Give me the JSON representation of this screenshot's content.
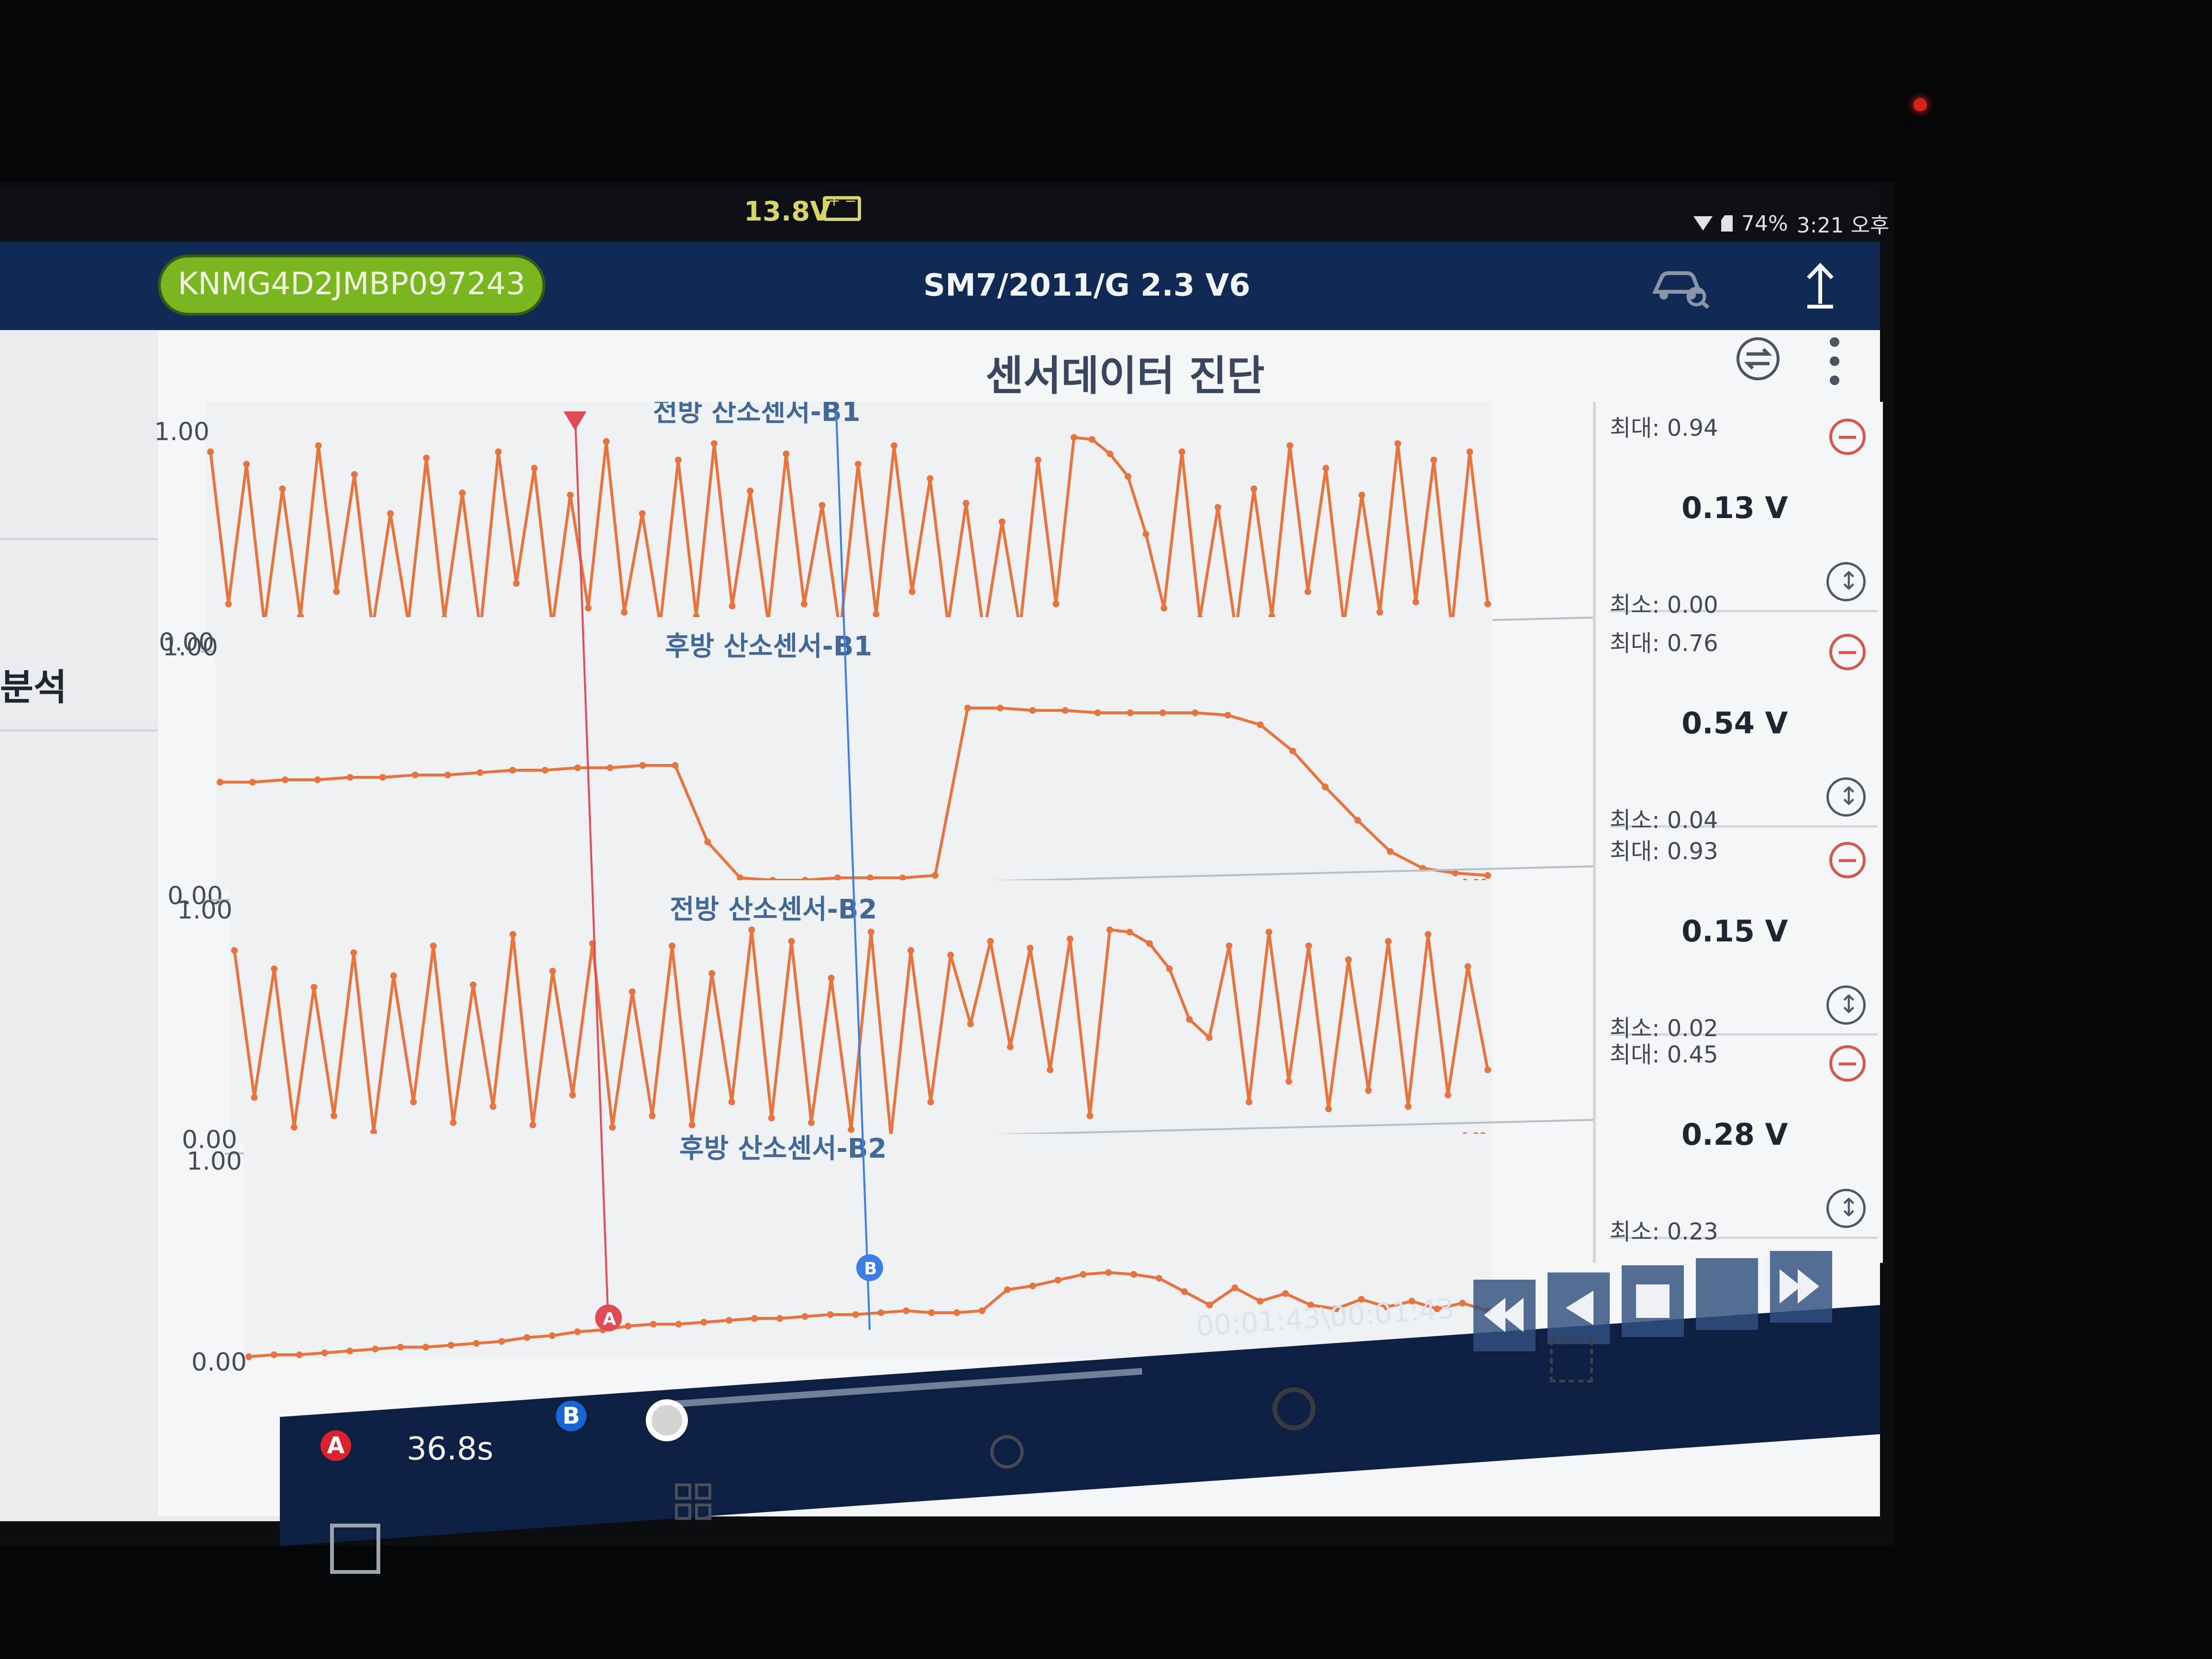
{
  "status": {
    "battery_voltage": "13.8V",
    "battery_percent": "74%",
    "time": "3:21 오후",
    "icons": [
      "battery-icon",
      "wifi-icon",
      "sim-icon"
    ]
  },
  "header": {
    "vin": "KNMG4D2JMBP097243",
    "vehicle": "SM7/2011/G 2.3 V6",
    "icons": [
      "car-search-icon",
      "upload-icon"
    ]
  },
  "left_panel": {
    "partial_label": "분석"
  },
  "page": {
    "title": "센서데이터 진단",
    "icons": [
      "swap-icon",
      "more-icon"
    ]
  },
  "chart_data": {
    "type": "line",
    "x_unit": "sample",
    "series": [
      {
        "name": "전방 산소센서-B1",
        "ylim": [
          0,
          1
        ],
        "ytick_labels": [
          "1.00",
          "0.00"
        ],
        "max": "최대: 0.94",
        "current": "0.13 V",
        "min": "최소: 0.00",
        "end_label": "0.20",
        "values": [
          0.92,
          0.18,
          0.86,
          0.08,
          0.74,
          0.12,
          0.95,
          0.24,
          0.81,
          0.06,
          0.62,
          0.09,
          0.89,
          0.11,
          0.72,
          0.05,
          0.92,
          0.28,
          0.84,
          0.07,
          0.71,
          0.16,
          0.97,
          0.14,
          0.62,
          0.08,
          0.88,
          0.12,
          0.96,
          0.17,
          0.73,
          0.09,
          0.91,
          0.18,
          0.66,
          0.04,
          0.86,
          0.13,
          0.95,
          0.24,
          0.79,
          0.08,
          0.67,
          0.03,
          0.58,
          0.06,
          0.88,
          0.18,
          0.99,
          0.98,
          0.91,
          0.8,
          0.52,
          0.16,
          0.92,
          0.11,
          0.65,
          0.05,
          0.74,
          0.12,
          0.95,
          0.24,
          0.84,
          0.08,
          0.71,
          0.14,
          0.96,
          0.19,
          0.88,
          0.06,
          0.92,
          0.18
        ]
      },
      {
        "name": "후방 산소센서-B1",
        "ylim": [
          0,
          1
        ],
        "ytick_labels": [
          "1.00",
          "0.00"
        ],
        "max": "최대: 0.76",
        "current": "0.54 V",
        "min": "최소: 0.04",
        "end_label": "0.06",
        "values": [
          0.45,
          0.45,
          0.46,
          0.46,
          0.47,
          0.47,
          0.48,
          0.48,
          0.49,
          0.5,
          0.5,
          0.51,
          0.51,
          0.52,
          0.52,
          0.2,
          0.05,
          0.04,
          0.04,
          0.05,
          0.05,
          0.05,
          0.06,
          0.76,
          0.76,
          0.75,
          0.75,
          0.74,
          0.74,
          0.74,
          0.74,
          0.73,
          0.69,
          0.58,
          0.43,
          0.29,
          0.16,
          0.09,
          0.07,
          0.06
        ]
      },
      {
        "name": "전방 산소센서-B2",
        "ylim": [
          0,
          1
        ],
        "ytick_labels": [
          "1.00",
          "0.00"
        ],
        "max": "최대: 0.93",
        "current": "0.15 V",
        "min": "최소: 0.02",
        "end_label": "0.32",
        "values": [
          0.84,
          0.2,
          0.76,
          0.07,
          0.68,
          0.12,
          0.83,
          0.05,
          0.73,
          0.18,
          0.86,
          0.09,
          0.69,
          0.16,
          0.91,
          0.08,
          0.75,
          0.21,
          0.87,
          0.07,
          0.66,
          0.12,
          0.86,
          0.08,
          0.74,
          0.18,
          0.93,
          0.11,
          0.88,
          0.09,
          0.72,
          0.06,
          0.92,
          0.03,
          0.84,
          0.18,
          0.82,
          0.52,
          0.88,
          0.42,
          0.85,
          0.32,
          0.89,
          0.12,
          0.93,
          0.92,
          0.87,
          0.76,
          0.54,
          0.46,
          0.86,
          0.18,
          0.92,
          0.27,
          0.86,
          0.15,
          0.8,
          0.23,
          0.88,
          0.16,
          0.91,
          0.21,
          0.77,
          0.32
        ]
      },
      {
        "name": "후방 산소센서-B2",
        "ylim": [
          0,
          1
        ],
        "ytick_labels": [
          "1.00",
          "0.00"
        ],
        "max": "최대: 0.45",
        "current": "0.28 V",
        "min": "최소: 0.23",
        "end_label": "0.00",
        "values": [
          0.01,
          0.02,
          0.02,
          0.03,
          0.04,
          0.05,
          0.06,
          0.06,
          0.07,
          0.08,
          0.09,
          0.11,
          0.12,
          0.14,
          0.15,
          0.17,
          0.18,
          0.18,
          0.19,
          0.2,
          0.21,
          0.21,
          0.22,
          0.23,
          0.23,
          0.24,
          0.25,
          0.24,
          0.24,
          0.25,
          0.36,
          0.38,
          0.41,
          0.44,
          0.45,
          0.44,
          0.42,
          0.35,
          0.28,
          0.37,
          0.3,
          0.34,
          0.28,
          0.26,
          0.31,
          0.27,
          0.3,
          0.26,
          0.29,
          0.25
        ]
      }
    ],
    "cursors": [
      {
        "label": "A",
        "position": 0.27,
        "color": "#e24a54"
      },
      {
        "label": "B",
        "position": 0.48,
        "color": "#3c7ee8"
      }
    ],
    "line_color": "#e8743b",
    "grid": false
  },
  "playback": {
    "cursor_a": "A",
    "cursor_b": "B",
    "duration": "36.8s",
    "timestamp": "00:01:43\\00:01:43",
    "icons": [
      "rewind-icon",
      "prev-icon",
      "stop-icon",
      "play-icon",
      "forward-icon"
    ]
  },
  "nav_icons": [
    "home-square-icon",
    "grid-icon",
    "globe-icon",
    "settings-icon",
    "fullscreen-icon"
  ]
}
